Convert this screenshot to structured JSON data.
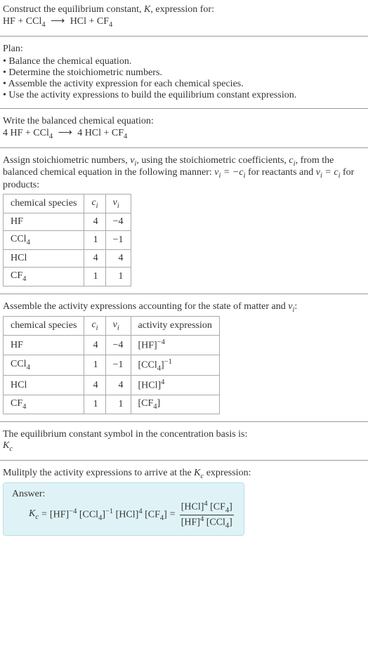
{
  "prompt": {
    "line1": "Construct the equilibrium constant, ",
    "kvar": "K",
    "line1b": ", expression for:",
    "reaction_lhs": "HF + CCl",
    "reaction_rhs": "HCl + CF"
  },
  "plan": {
    "heading": "Plan:",
    "items": [
      "• Balance the chemical equation.",
      "• Determine the stoichiometric numbers.",
      "• Assemble the activity expression for each chemical species.",
      "• Use the activity expressions to build the equilibrium constant expression."
    ]
  },
  "balanced": {
    "heading": "Write the balanced chemical equation:",
    "lhs_coeff1": "4",
    "rhs_coeff1": "4"
  },
  "stoich": {
    "text1": "Assign stoichiometric numbers, ",
    "nu": "ν",
    "text2": ", using the stoichiometric coefficients, ",
    "c": "c",
    "text3": ", from the balanced chemical equation in the following manner: ",
    "ruleReact": " = −",
    "textReact": " for reactants and ",
    "ruleProd": " = ",
    "textProd": " for products:",
    "headers": [
      "chemical species",
      "c",
      "ν"
    ],
    "rows": [
      {
        "sp": "HF",
        "c": "4",
        "nu": "−4"
      },
      {
        "sp": "CCl",
        "sub": "4",
        "c": "1",
        "nu": "−1"
      },
      {
        "sp": "HCl",
        "c": "4",
        "nu": "4"
      },
      {
        "sp": "CF",
        "sub": "4",
        "c": "1",
        "nu": "1"
      }
    ]
  },
  "activity": {
    "heading": "Assemble the activity expressions accounting for the state of matter and ",
    "headers": [
      "chemical species",
      "c",
      "ν",
      "activity expression"
    ],
    "rows": [
      {
        "sp": "HF",
        "c": "4",
        "nu": "−4",
        "base": "[HF]",
        "exp": "−4"
      },
      {
        "sp": "CCl",
        "sub": "4",
        "c": "1",
        "nu": "−1",
        "base": "[CCl",
        "bsub": "4",
        "bend": "]",
        "exp": "−1"
      },
      {
        "sp": "HCl",
        "c": "4",
        "nu": "4",
        "base": "[HCl]",
        "exp": "4"
      },
      {
        "sp": "CF",
        "sub": "4",
        "c": "1",
        "nu": "1",
        "base": "[CF",
        "bsub": "4",
        "bend": "]"
      }
    ]
  },
  "kc_basis": {
    "line1": "The equilibrium constant symbol in the concentration basis is:",
    "symbol": "K",
    "sub": "c"
  },
  "final": {
    "heading": "Mulitply the activity expressions to arrive at the ",
    "kc": "K",
    "kcsub": "c",
    "heading2": " expression:",
    "answer_label": "Answer:"
  }
}
